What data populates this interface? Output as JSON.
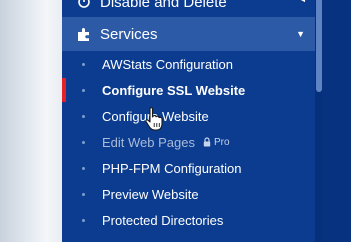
{
  "sidebar": {
    "menu": {
      "disable_delete": "Disable and Delete",
      "services": "Services"
    },
    "submenu": [
      {
        "label": "AWStats Configuration",
        "state": "normal"
      },
      {
        "label": "Configure SSL Website",
        "state": "active"
      },
      {
        "label": "Configure Website",
        "state": "normal"
      },
      {
        "label": "Edit Web Pages",
        "state": "locked"
      },
      {
        "label": "PHP-FPM Configuration",
        "state": "normal"
      },
      {
        "label": "Preview Website",
        "state": "normal"
      },
      {
        "label": "Protected Directories",
        "state": "normal"
      }
    ],
    "pro_badge": "Pro",
    "colors": {
      "sidebar_bg": "#0b3c8f",
      "section_highlight": "#2c5aa6",
      "active_marker": "#e4202b"
    }
  },
  "icons": {
    "disable_delete": "toggle-icon",
    "services": "puzzle-icon",
    "lock": "lock-icon",
    "cursor": "hand-pointer-icon"
  }
}
